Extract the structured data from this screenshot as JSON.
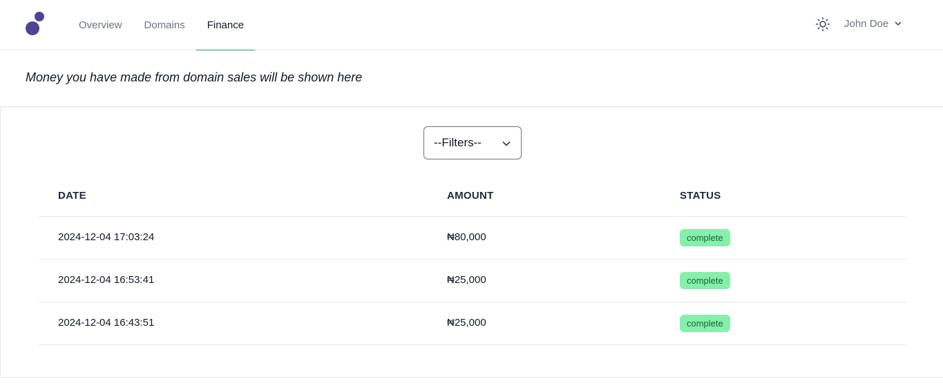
{
  "brand": {
    "logo_icon": "app-logo-icon",
    "accent": "#4c4595"
  },
  "nav": {
    "tabs": [
      {
        "label": "Overview",
        "active": false
      },
      {
        "label": "Domains",
        "active": false
      },
      {
        "label": "Finance",
        "active": true
      }
    ],
    "active_indicator_color": "#22a05b"
  },
  "header": {
    "theme_toggle_icon": "sun-icon",
    "user_name": "John Doe",
    "user_menu_icon": "chevron-down-icon"
  },
  "subheader": {
    "message": "Money you have made from domain sales will be shown here"
  },
  "filter": {
    "selected": "--Filters--",
    "icon": "chevron-down-icon"
  },
  "table": {
    "columns": [
      "DATE",
      "AMOUNT",
      "STATUS"
    ],
    "rows": [
      {
        "date": "2024-12-04 17:03:24",
        "amount": "₦80,000",
        "status": "complete"
      },
      {
        "date": "2024-12-04 16:53:41",
        "amount": "₦25,000",
        "status": "complete"
      },
      {
        "date": "2024-12-04 16:43:51",
        "amount": "₦25,000",
        "status": "complete"
      }
    ],
    "status_badge_bg": "#86efac",
    "status_badge_text": "#166534"
  }
}
